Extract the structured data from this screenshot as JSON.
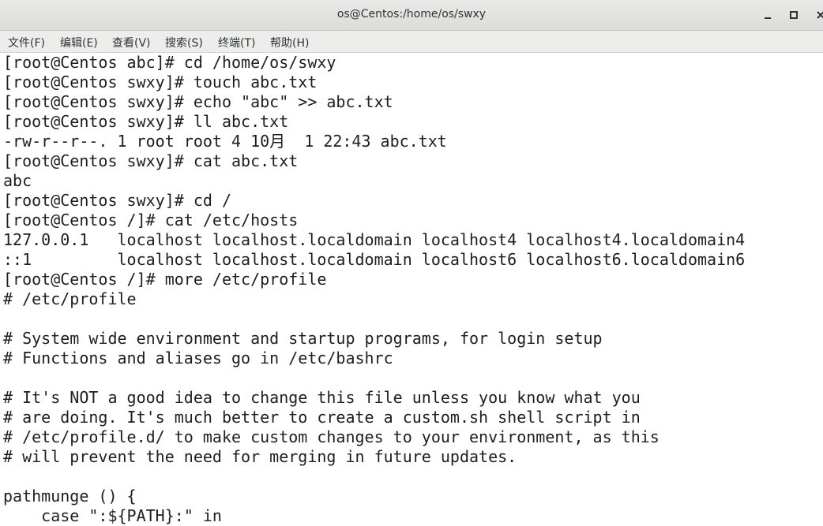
{
  "window": {
    "title": "os@Centos:/home/os/swxy",
    "minimize_icon": "minimize-icon",
    "maximize_icon": "maximize-icon",
    "close_icon": "close-icon"
  },
  "menu": [
    "文件(F)",
    "编辑(E)",
    "查看(V)",
    "搜索(S)",
    "终端(T)",
    "帮助(H)"
  ],
  "terminal": {
    "lines": [
      "[root@Centos abc]# cd /home/os/swxy",
      "[root@Centos swxy]# touch abc.txt",
      "[root@Centos swxy]# echo \"abc\" >> abc.txt",
      "[root@Centos swxy]# ll abc.txt",
      "-rw-r--r--. 1 root root 4 10月  1 22:43 abc.txt",
      "[root@Centos swxy]# cat abc.txt",
      "abc",
      "[root@Centos swxy]# cd /",
      "[root@Centos /]# cat /etc/hosts",
      "127.0.0.1   localhost localhost.localdomain localhost4 localhost4.localdomain4",
      "::1         localhost localhost.localdomain localhost6 localhost6.localdomain6",
      "[root@Centos /]# more /etc/profile",
      "# /etc/profile",
      "",
      "# System wide environment and startup programs, for login setup",
      "# Functions and aliases go in /etc/bashrc",
      "",
      "# It's NOT a good idea to change this file unless you know what you",
      "# are doing. It's much better to create a custom.sh shell script in",
      "# /etc/profile.d/ to make custom changes to your environment, as this",
      "# will prevent the need for merging in future updates.",
      "",
      "pathmunge () {",
      "    case \":${PATH}:\" in"
    ]
  }
}
